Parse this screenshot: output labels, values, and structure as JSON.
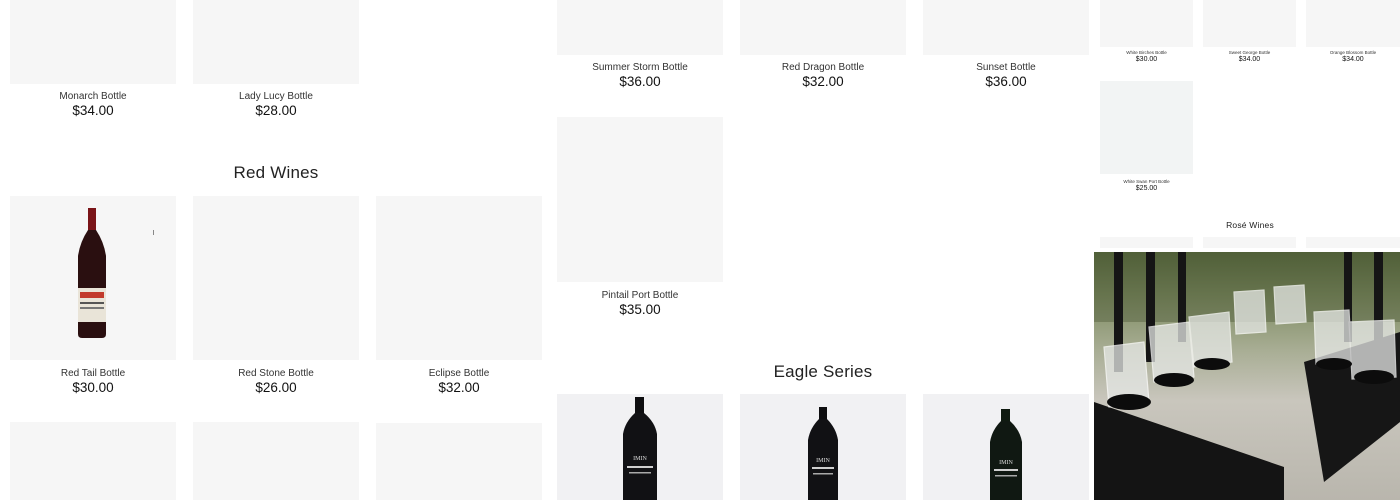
{
  "products_top_left": [
    {
      "name": "Monarch Bottle",
      "price": "$34.00"
    },
    {
      "name": "Lady Lucy Bottle",
      "price": "$28.00"
    }
  ],
  "red_wines": {
    "title": "Red Wines",
    "row1": [
      {
        "name": "Red Tail Bottle",
        "price": "$30.00"
      },
      {
        "name": "Red Stone Bottle",
        "price": "$26.00"
      },
      {
        "name": "Eclipse Bottle",
        "price": "$32.00"
      }
    ]
  },
  "middle_top": [
    {
      "name": "Summer Storm Bottle",
      "price": "$36.00"
    },
    {
      "name": "Red Dragon Bottle",
      "price": "$32.00"
    },
    {
      "name": "Sunset Bottle",
      "price": "$36.00"
    }
  ],
  "middle_second": [
    {
      "name": "Pintail Port Bottle",
      "price": "$35.00"
    }
  ],
  "eagle_series": {
    "title": "Eagle Series"
  },
  "mini_panel": {
    "row1": [
      {
        "name": "White Birches Bottle",
        "price": "$30.00"
      },
      {
        "name": "Sweet George Bottle",
        "price": "$34.00"
      },
      {
        "name": "Orange Blossom Bottle",
        "price": "$34.00"
      }
    ],
    "row2": [
      {
        "name": "White Swan Port Bottle",
        "price": "$25.00"
      }
    ],
    "rose_title": "Rosé Wines"
  },
  "colors": {
    "card_bg": "#f6f6f6",
    "text": "#222222"
  }
}
